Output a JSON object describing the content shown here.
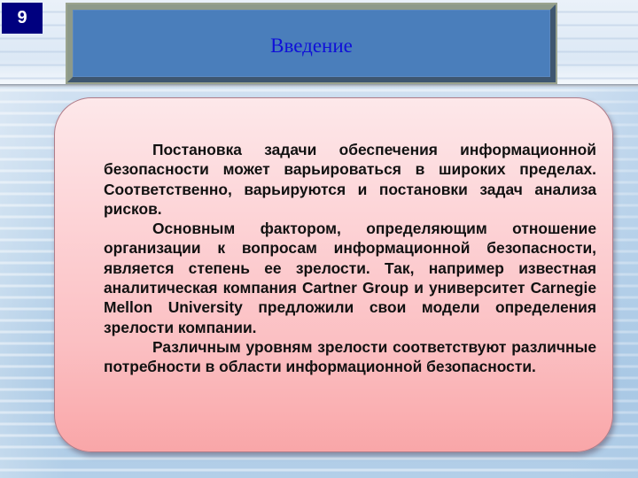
{
  "slide": {
    "number": "9",
    "title": "Введение",
    "paragraphs": [
      "Постановка задачи обеспечения информационной безопасности может варьироваться в широких пределах. Соответственно, варьируются и постановки задач анализа рисков.",
      "Основным фактором, определяющим отношение организации к вопросам информационной безопасности, является степень ее зрелости. Так, например известная аналитическая компания Cartner Group и университет Carnegie Mellon University предложили свои модели определения зрелости компании.",
      "Различным уровням зрелости соответствуют различные потребности в области информационной безопасности."
    ]
  },
  "colors": {
    "badge_background": "#00007f",
    "badge_text": "#ffffff",
    "title_box_fill": "#4a7ebb",
    "title_text": "#1010d8",
    "card_fill_top": "#fde8ea",
    "card_fill_bottom": "#f9a6a8",
    "body_text": "#111111"
  }
}
